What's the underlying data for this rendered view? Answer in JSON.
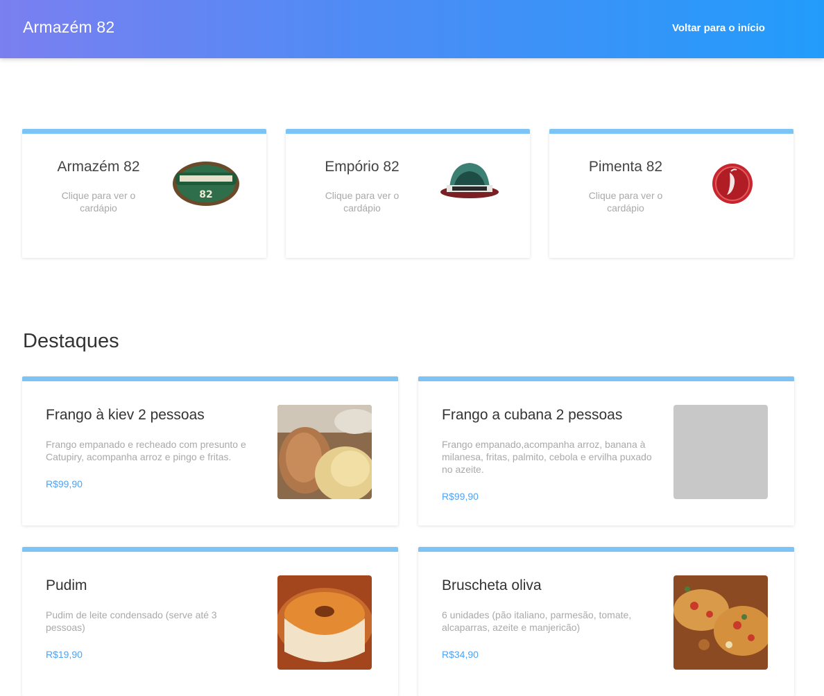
{
  "header": {
    "brand": "Armazém 82",
    "back_link": "Voltar para o início",
    "gradient": [
      "#7b7ff0",
      "#229cfb"
    ]
  },
  "stores": [
    {
      "name": "Armazém 82",
      "hint": "Clique para ver o cardápio",
      "logo": "armazem-logo"
    },
    {
      "name": "Empório 82",
      "hint": "Clique para ver o cardápio",
      "logo": "emporio-logo"
    },
    {
      "name": "Pimenta 82",
      "hint": "Clique para ver o cardápio",
      "logo": "pimenta-logo"
    }
  ],
  "highlights": {
    "title": "Destaques",
    "dishes": [
      {
        "name": "Frango à kiev 2 pessoas",
        "description": "Frango empanado e recheado com presunto e Catupiry, acompanha arroz e pingo e fritas.",
        "price": "R$99,90",
        "image": "chicken-photo"
      },
      {
        "name": "Frango a cubana 2 pessoas",
        "description": "Frango empanado,acompanha arroz, banana à milanesa, fritas, palmito, cebola e ervilha puxado no azeite.",
        "price": "R$99,90",
        "image": "placeholder"
      },
      {
        "name": "Pudim",
        "description": "Pudim de leite condensado (serve até 3 pessoas)",
        "price": "R$19,90",
        "image": "pudding-photo"
      },
      {
        "name": "Bruscheta oliva",
        "description": "6 unidades (pão italiano, parmesão, tomate, alcaparras, azeite e manjericão)",
        "price": "R$34,90",
        "image": "bruschetta-photo"
      }
    ]
  },
  "colors": {
    "accent_border": "#7cc4f5",
    "price": "#4da3f5"
  }
}
